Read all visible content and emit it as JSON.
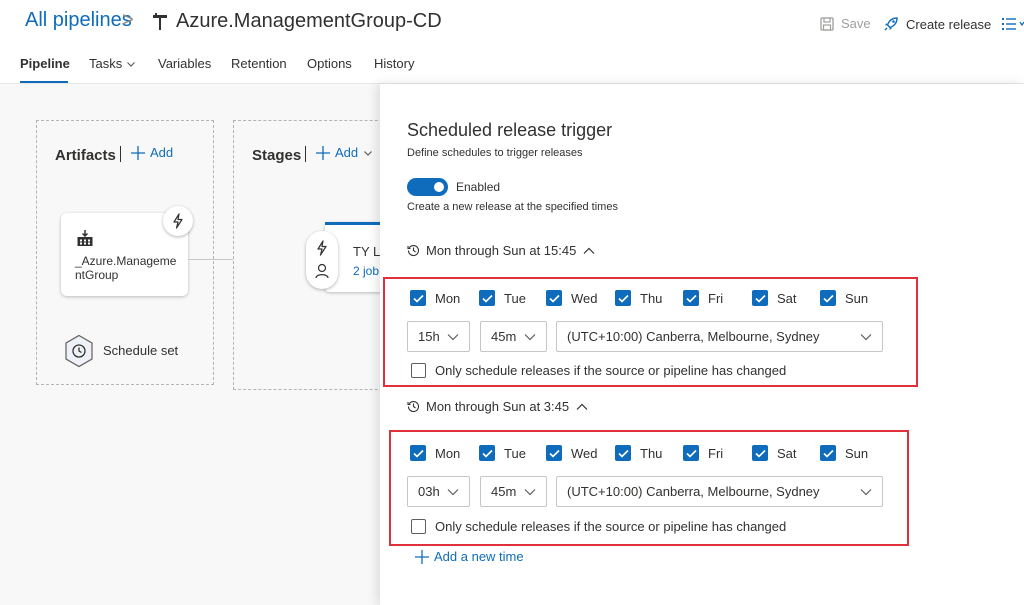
{
  "header": {
    "breadcrumb_root": "All pipelines",
    "breadcrumb_sep": ">",
    "pipeline_name": "Azure.ManagementGroup-CD",
    "save_label": "Save",
    "create_release_label": "Create release"
  },
  "tabs": [
    {
      "label": "Pipeline",
      "active": true
    },
    {
      "label": "Tasks",
      "has_dropdown": true
    },
    {
      "label": "Variables"
    },
    {
      "label": "Retention"
    },
    {
      "label": "Options"
    },
    {
      "label": "History"
    }
  ],
  "canvas": {
    "artifacts": {
      "title": "Artifacts",
      "add_label": "Add",
      "artifact_name": "_Azure.ManagementGroup",
      "artifact_name_line1": "_Azure.Manageme",
      "artifact_name_line2": "ntGroup",
      "schedule_label": "Schedule set"
    },
    "stages": {
      "title": "Stages",
      "add_label": "Add",
      "stage_name": "TY L",
      "stage_jobs": "2 job"
    }
  },
  "panel": {
    "title": "Scheduled release trigger",
    "subtitle": "Define schedules to trigger releases",
    "toggle_label": "Enabled",
    "toggle_on": true,
    "toggle_help": "Create a new release at the specified times",
    "schedules": [
      {
        "header": "Mon through Sun at 15:45",
        "days": [
          {
            "label": "Mon",
            "checked": true
          },
          {
            "label": "Tue",
            "checked": true
          },
          {
            "label": "Wed",
            "checked": true
          },
          {
            "label": "Thu",
            "checked": true
          },
          {
            "label": "Fri",
            "checked": true
          },
          {
            "label": "Sat",
            "checked": true
          },
          {
            "label": "Sun",
            "checked": true
          }
        ],
        "hour": "15h",
        "minute": "45m",
        "timezone": "(UTC+10:00) Canberra, Melbourne, Sydney",
        "only_changed_label": "Only schedule releases if the source or pipeline has changed",
        "only_changed": false
      },
      {
        "header": "Mon through Sun at 3:45",
        "days": [
          {
            "label": "Mon",
            "checked": true
          },
          {
            "label": "Tue",
            "checked": true
          },
          {
            "label": "Wed",
            "checked": true
          },
          {
            "label": "Thu",
            "checked": true
          },
          {
            "label": "Fri",
            "checked": true
          },
          {
            "label": "Sat",
            "checked": true
          },
          {
            "label": "Sun",
            "checked": true
          }
        ],
        "hour": "03h",
        "minute": "45m",
        "timezone": "(UTC+10:00) Canberra, Melbourne, Sydney",
        "only_changed_label": "Only schedule releases if the source or pipeline has changed",
        "only_changed": false
      }
    ],
    "add_time_label": "Add a new time"
  },
  "colors": {
    "accent": "#0f6cbd",
    "highlight_border": "#e0303c"
  }
}
